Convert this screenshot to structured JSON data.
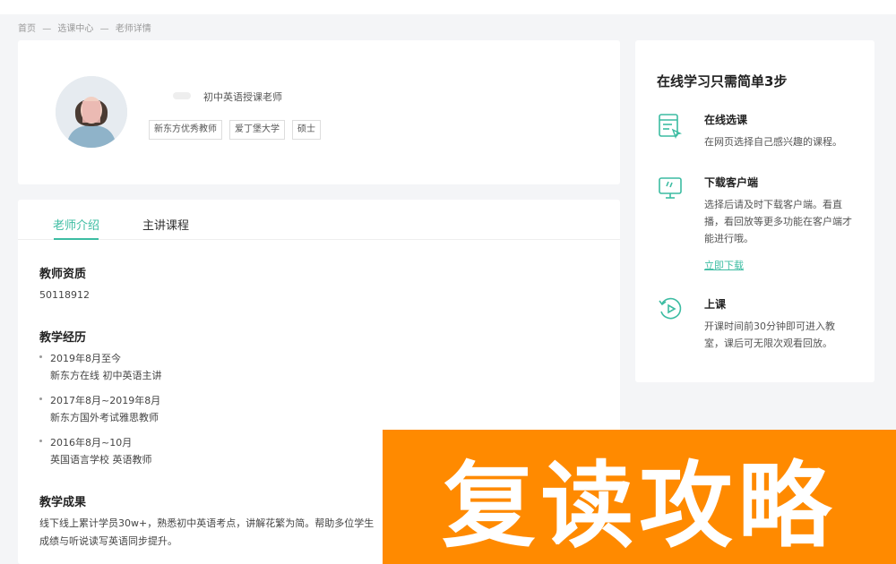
{
  "breadcrumb": [
    "首页",
    "—",
    "选课中心",
    "—",
    "老师详情"
  ],
  "profile": {
    "role": "初中英语授课老师",
    "tags": [
      "新东方优秀教师",
      "爱丁堡大学",
      "硕士"
    ]
  },
  "tabs": [
    {
      "label": "老师介绍",
      "active": true
    },
    {
      "label": "主讲课程",
      "active": false
    }
  ],
  "qualification": {
    "title": "教师资质",
    "value": "50118912"
  },
  "experience": {
    "title": "教学经历",
    "items": [
      {
        "date": "2019年8月至今",
        "desc": "新东方在线 初中英语主讲"
      },
      {
        "date": "2017年8月~2019年8月",
        "desc": "新东方国外考试雅思教师"
      },
      {
        "date": "2016年8月~10月",
        "desc": "英国语言学校 英语教师"
      }
    ]
  },
  "results": {
    "title": "教学成果",
    "text": "线下线上累计学员30w+，熟悉初中英语考点，讲解花繁为简。帮助多位学生",
    "text2": "成绩与听说读写英语同步提升。"
  },
  "steps": {
    "title": "在线学习只需简单3步",
    "items": [
      {
        "icon": "course-list-icon",
        "title": "在线选课",
        "desc": "在网页选择自己感兴趣的课程。"
      },
      {
        "icon": "monitor-download-icon",
        "title": "下载客户端",
        "desc": "选择后请及时下载客户端。看直播，看回放等更多功能在客户端才能进行哦。",
        "link": "立即下载"
      },
      {
        "icon": "play-replay-icon",
        "title": "上课",
        "desc": "开课时间前30分钟即可进入教室，课后可无限次观看回放。"
      }
    ]
  },
  "banner": {
    "text": "复读攻略"
  },
  "colors": {
    "accent": "#3cbca2",
    "banner": "#ff8a00"
  }
}
